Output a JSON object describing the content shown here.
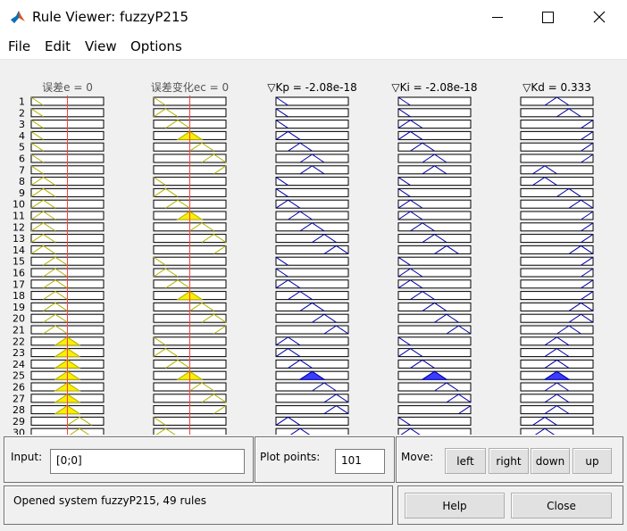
{
  "window": {
    "title": "Rule Viewer: fuzzyP215",
    "minimize_glyph": "—",
    "maximize_glyph": "☐",
    "close_glyph": "✕"
  },
  "menu": [
    "File",
    "Edit",
    "View",
    "Options"
  ],
  "variables": [
    {
      "label": "误差e = 0",
      "kind": "input"
    },
    {
      "label": "误差变化ec = 0",
      "kind": "input"
    },
    {
      "label": "▽Kp = -2.08e-18",
      "kind": "output"
    },
    {
      "label": "▽Ki = -2.08e-18",
      "kind": "output"
    },
    {
      "label": "▽Kd = 0.333",
      "kind": "output"
    }
  ],
  "input_values": [
    0,
    0
  ],
  "visible_rule_numbers": [
    "1",
    "2",
    "3",
    "4",
    "5",
    "6",
    "7",
    "8",
    "9",
    "10",
    "11",
    "12",
    "13",
    "14",
    "15",
    "16",
    "17",
    "18",
    "19",
    "20",
    "21",
    "22",
    "23",
    "24",
    "25",
    "26",
    "27",
    "28",
    "29",
    "30"
  ],
  "rules": [
    {
      "e": 0,
      "ec": 0,
      "kp": 0,
      "ki": 0,
      "kd": 3
    },
    {
      "e": 0,
      "ec": 1,
      "kp": 0,
      "ki": 0,
      "kd": 4
    },
    {
      "e": 0,
      "ec": 2,
      "kp": 0,
      "ki": 1,
      "kd": 6
    },
    {
      "e": 0,
      "ec": 3,
      "kp": 1,
      "ki": 1,
      "kd": 6
    },
    {
      "e": 0,
      "ec": 4,
      "kp": 2,
      "ki": 2,
      "kd": 6
    },
    {
      "e": 0,
      "ec": 5,
      "kp": 3,
      "ki": 3,
      "kd": 6
    },
    {
      "e": 0,
      "ec": 6,
      "kp": 3,
      "ki": 3,
      "kd": 2
    },
    {
      "e": 1,
      "ec": 0,
      "kp": 0,
      "ki": 0,
      "kd": 2
    },
    {
      "e": 1,
      "ec": 1,
      "kp": 0,
      "ki": 0,
      "kd": 4
    },
    {
      "e": 1,
      "ec": 2,
      "kp": 1,
      "ki": 1,
      "kd": 5
    },
    {
      "e": 1,
      "ec": 3,
      "kp": 2,
      "ki": 1,
      "kd": 6
    },
    {
      "e": 1,
      "ec": 4,
      "kp": 3,
      "ki": 2,
      "kd": 6
    },
    {
      "e": 1,
      "ec": 5,
      "kp": 4,
      "ki": 3,
      "kd": 6
    },
    {
      "e": 1,
      "ec": 6,
      "kp": 5,
      "ki": 4,
      "kd": 5
    },
    {
      "e": 2,
      "ec": 0,
      "kp": 0,
      "ki": 0,
      "kd": 6
    },
    {
      "e": 2,
      "ec": 1,
      "kp": 0,
      "ki": 1,
      "kd": 6
    },
    {
      "e": 2,
      "ec": 2,
      "kp": 1,
      "ki": 1,
      "kd": 6
    },
    {
      "e": 2,
      "ec": 3,
      "kp": 2,
      "ki": 2,
      "kd": 6
    },
    {
      "e": 2,
      "ec": 4,
      "kp": 3,
      "ki": 3,
      "kd": 5
    },
    {
      "e": 2,
      "ec": 5,
      "kp": 4,
      "ki": 4,
      "kd": 5
    },
    {
      "e": 2,
      "ec": 6,
      "kp": 5,
      "ki": 5,
      "kd": 4
    },
    {
      "e": 3,
      "ec": 0,
      "kp": 1,
      "ki": 0,
      "kd": 3
    },
    {
      "e": 3,
      "ec": 1,
      "kp": 1,
      "ki": 1,
      "kd": 3
    },
    {
      "e": 3,
      "ec": 2,
      "kp": 2,
      "ki": 2,
      "kd": 3
    },
    {
      "e": 3,
      "ec": 3,
      "kp": 3,
      "ki": 3,
      "kd": 3
    },
    {
      "e": 3,
      "ec": 4,
      "kp": 4,
      "ki": 4,
      "kd": 3
    },
    {
      "e": 3,
      "ec": 5,
      "kp": 5,
      "ki": 5,
      "kd": 3
    },
    {
      "e": 3,
      "ec": 6,
      "kp": 5,
      "ki": 6,
      "kd": 3
    },
    {
      "e": 4,
      "ec": 0,
      "kp": 1,
      "ki": 0,
      "kd": 2
    },
    {
      "e": 4,
      "ec": 1,
      "kp": 2,
      "ki": 1,
      "kd": 2
    }
  ],
  "colors": {
    "input_line": "#b3b300",
    "input_fill": "#ffee00",
    "output_line": "#0000a6",
    "output_fill": "#3c3cff",
    "index_line": "#ff3c3c"
  },
  "input_panel": {
    "label": "Input:",
    "value": "[0;0]"
  },
  "plot_points": {
    "label": "Plot points:",
    "value": "101"
  },
  "move": {
    "label": "Move:",
    "buttons": [
      "left",
      "right",
      "down",
      "up"
    ]
  },
  "status": "Opened system fuzzyP215, 49 rules",
  "help_label": "Help",
  "close_label": "Close"
}
